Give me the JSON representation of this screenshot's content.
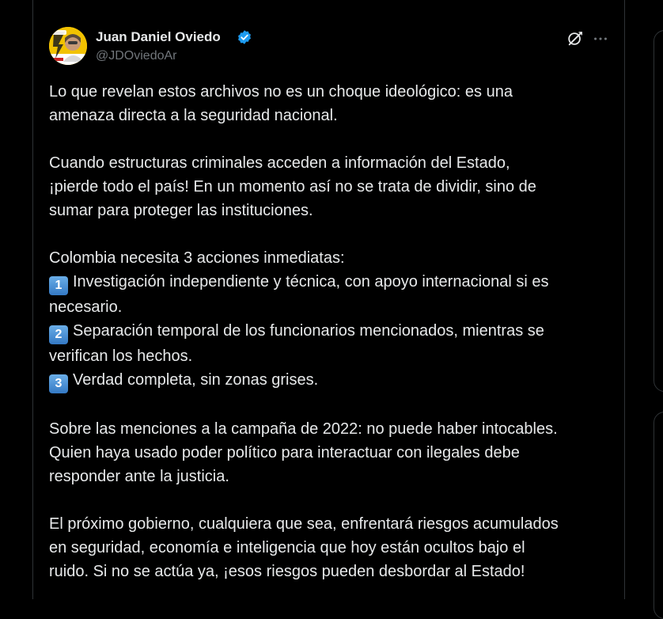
{
  "author": {
    "name": "Juan Daniel Oviedo",
    "handle": "@JDOviedoAr",
    "verified": true,
    "verified_color": "#1d9bf0"
  },
  "icons": {
    "avatar": "profile-avatar",
    "verified": "verified-badge-icon",
    "grok": "grok-icon",
    "more": "more-options-icon"
  },
  "tweet": {
    "para1": [
      "Lo que revelan estos archivos no es un choque ideológico: es una",
      "amenaza directa a la seguridad nacional."
    ],
    "para2": [
      "Cuando estructuras criminales acceden a información del Estado,",
      "¡pierde todo el país! En un momento así no se trata de dividir, sino de",
      "sumar para proteger las instituciones."
    ],
    "para3_intro": "Colombia necesita 3 acciones inmediatas:",
    "actions": [
      {
        "number": "1",
        "lines": [
          "Investigación independiente y técnica, con apoyo internacional si es",
          "necesario."
        ]
      },
      {
        "number": "2",
        "lines": [
          "Separación temporal de los funcionarios mencionados, mientras se",
          "verifican los hechos."
        ]
      },
      {
        "number": "3",
        "lines": [
          "Verdad completa, sin zonas grises."
        ]
      }
    ],
    "para4": [
      "Sobre las menciones a la campaña de 2022: no puede haber intocables.",
      "Quien haya usado poder político para interactuar con ilegales debe",
      "responder ante la justicia."
    ],
    "para5": [
      "El próximo gobierno, cualquiera que sea, enfrentará riesgos acumulados",
      "en seguridad, economía e inteligencia que hoy están ocultos bajo el",
      "ruido. Si no se actúa ya, ¡esos riesgos pueden desbordar al Estado!"
    ]
  },
  "colors": {
    "background": "#000000",
    "text": "#e7e9ea",
    "secondary_text": "#71767b",
    "border": "#2f3336",
    "keycap": "#4a8fd4"
  }
}
